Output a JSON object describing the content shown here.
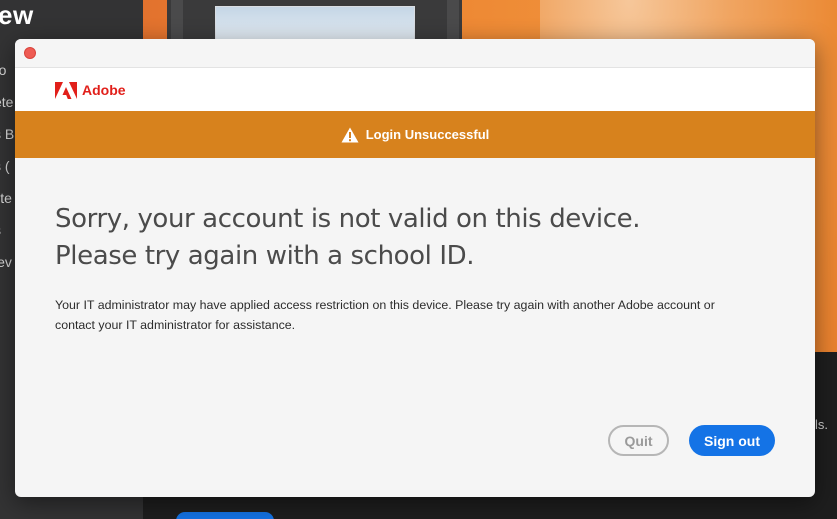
{
  "background": {
    "app_title": "ew",
    "sidebar_fragments": [
      "ro",
      "ete",
      "s Bl",
      "s (",
      "ilte",
      "s",
      "iev"
    ],
    "side_text": "ls."
  },
  "dialog": {
    "brand": "Adobe",
    "alert": {
      "text": "Login Unsuccessful",
      "color": "#d7821d"
    },
    "headline_lines": [
      "Sorry, your account is not valid on this device.",
      "Please try again with a school ID."
    ],
    "body_lines": [
      "Your IT administrator may have applied access restriction on this device. Please try again with another Adobe account or",
      "contact your IT administrator for assistance."
    ],
    "buttons": {
      "quit": "Quit",
      "sign_out": "Sign out"
    },
    "colors": {
      "brand": "#e11f1a",
      "primary_button": "#1473e6",
      "close_button": "#ee5b53"
    }
  }
}
